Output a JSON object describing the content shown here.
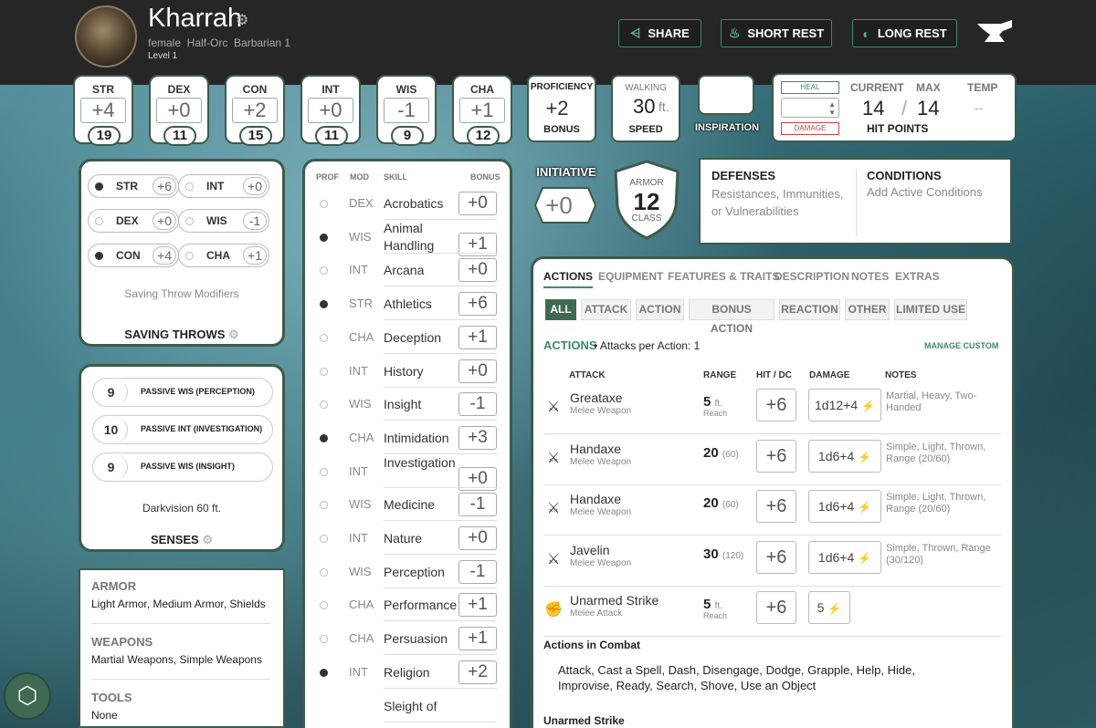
{
  "header": {
    "name": "Kharrah",
    "gear_icon": "gear-icon",
    "description": "female  Half-Orc  Barbarian 1",
    "level": "Level 1",
    "buttons": [
      {
        "label": "SHARE",
        "icon": "share-icon"
      },
      {
        "label": "SHORT REST",
        "icon": "campfire-icon"
      },
      {
        "label": "LONG REST",
        "icon": "moon-icon"
      }
    ],
    "logo": "anvil-logo",
    "accent_color": "#3f8a6a"
  },
  "abilities": [
    {
      "name": "STR",
      "mod": "+4",
      "score": "19"
    },
    {
      "name": "DEX",
      "mod": "+0",
      "score": "11"
    },
    {
      "name": "CON",
      "mod": "+2",
      "score": "15"
    },
    {
      "name": "INT",
      "mod": "+0",
      "score": "11"
    },
    {
      "name": "WIS",
      "mod": "-1",
      "score": "9"
    },
    {
      "name": "CHA",
      "mod": "+1",
      "score": "12"
    }
  ],
  "proficiency": {
    "label_top": "PROFICIENCY",
    "value": "+2",
    "label_bottom": "BONUS"
  },
  "speed": {
    "label_top": "WALKING",
    "value": "30",
    "unit": "ft.",
    "label_bottom": "SPEED"
  },
  "inspiration": {
    "label": "INSPIRATION"
  },
  "hit_points": {
    "heal_label": "HEAL",
    "damage_label": "DAMAGE",
    "current_label": "CURRENT",
    "max_label": "MAX",
    "temp_label": "TEMP",
    "current": "14",
    "separator": "/",
    "max": "14",
    "temp": "--",
    "label": "HIT POINTS"
  },
  "initiative": {
    "label": "INITIATIVE",
    "value": "+0"
  },
  "armor": {
    "label_top": "ARMOR",
    "value": "12",
    "label_bottom": "CLASS"
  },
  "defenses": {
    "title": "DEFENSES",
    "text": "Resistances, Immunities, or Vulnerabilities"
  },
  "conditions": {
    "title": "CONDITIONS",
    "text": "Add Active Conditions"
  },
  "saving_throws": {
    "items": [
      {
        "name": "STR",
        "value": "+6",
        "proficient": true
      },
      {
        "name": "INT",
        "value": "+0",
        "proficient": false
      },
      {
        "name": "DEX",
        "value": "+0",
        "proficient": false
      },
      {
        "name": "WIS",
        "value": "-1",
        "proficient": false
      },
      {
        "name": "CON",
        "value": "+4",
        "proficient": true
      },
      {
        "name": "CHA",
        "value": "+1",
        "proficient": false
      }
    ],
    "modifiers_label": "Saving Throw Modifiers",
    "title": "SAVING THROWS"
  },
  "senses": {
    "items": [
      {
        "value": "9",
        "label": "PASSIVE WIS (PERCEPTION)"
      },
      {
        "value": "10",
        "label": "PASSIVE INT (INVESTIGATION)"
      },
      {
        "value": "9",
        "label": "PASSIVE WIS (INSIGHT)"
      }
    ],
    "darkvision": "Darkvision 60 ft.",
    "title": "SENSES"
  },
  "proficiencies": {
    "armor_title": "ARMOR",
    "armor": "Light Armor, Medium Armor, Shields",
    "weapons_title": "WEAPONS",
    "weapons": "Martial Weapons, Simple Weapons",
    "tools_title": "TOOLS",
    "tools": "None"
  },
  "skills": {
    "headers": {
      "prof": "PROF",
      "mod": "MOD",
      "skill": "SKILL",
      "bonus": "BONUS"
    },
    "items": [
      {
        "mod": "DEX",
        "name": "Acrobatics",
        "bonus": "+0",
        "proficient": false
      },
      {
        "mod": "WIS",
        "name": "Animal Handling",
        "bonus": "+1",
        "proficient": true
      },
      {
        "mod": "INT",
        "name": "Arcana",
        "bonus": "+0",
        "proficient": false
      },
      {
        "mod": "STR",
        "name": "Athletics",
        "bonus": "+6",
        "proficient": true
      },
      {
        "mod": "CHA",
        "name": "Deception",
        "bonus": "+1",
        "proficient": false
      },
      {
        "mod": "INT",
        "name": "History",
        "bonus": "+0",
        "proficient": false
      },
      {
        "mod": "WIS",
        "name": "Insight",
        "bonus": "-1",
        "proficient": false
      },
      {
        "mod": "CHA",
        "name": "Intimidation",
        "bonus": "+3",
        "proficient": true
      },
      {
        "mod": "INT",
        "name": "Investigation",
        "bonus": "+0",
        "proficient": false
      },
      {
        "mod": "WIS",
        "name": "Medicine",
        "bonus": "-1",
        "proficient": false
      },
      {
        "mod": "INT",
        "name": "Nature",
        "bonus": "+0",
        "proficient": false
      },
      {
        "mod": "WIS",
        "name": "Perception",
        "bonus": "-1",
        "proficient": false
      },
      {
        "mod": "CHA",
        "name": "Performance",
        "bonus": "+1",
        "proficient": false
      },
      {
        "mod": "CHA",
        "name": "Persuasion",
        "bonus": "+1",
        "proficient": false
      },
      {
        "mod": "INT",
        "name": "Religion",
        "bonus": "+2",
        "proficient": true
      },
      {
        "mod": "",
        "name": "Sleight of",
        "bonus": "",
        "proficient": false
      }
    ]
  },
  "actions_panel": {
    "tabs": [
      "ACTIONS",
      "EQUIPMENT",
      "FEATURES & TRAITS",
      "DESCRIPTION",
      "NOTES",
      "EXTRAS"
    ],
    "filters": [
      "ALL",
      "ATTACK",
      "ACTION",
      "BONUS ACTION",
      "REACTION",
      "OTHER",
      "LIMITED USE"
    ],
    "section_title": "ACTIONS",
    "attacks_per_action": "• Attacks per Action: 1",
    "manage_custom": "MANAGE CUSTOM",
    "columns": {
      "attack": "ATTACK",
      "range": "RANGE",
      "hit": "HIT / DC",
      "damage": "DAMAGE",
      "notes": "NOTES"
    },
    "attacks": [
      {
        "icon": "crossed-swords-icon",
        "name": "Greataxe",
        "type": "Melee Weapon",
        "range": "5",
        "range_unit": "ft.",
        "range_sub": "Reach",
        "hit": "+6",
        "damage": "1d12+4",
        "notes": "Martial, Heavy, Two-Handed"
      },
      {
        "icon": "crossed-swords-icon",
        "name": "Handaxe",
        "type": "Melee Weapon",
        "range": "20",
        "range_unit": "(60)",
        "range_sub": "",
        "hit": "+6",
        "damage": "1d6+4",
        "notes": "Simple, Light, Thrown, Range (20/60)"
      },
      {
        "icon": "crossed-swords-icon",
        "name": "Handaxe",
        "type": "Melee Weapon",
        "range": "20",
        "range_unit": "(60)",
        "range_sub": "",
        "hit": "+6",
        "damage": "1d6+4",
        "notes": "Simple, Light, Thrown, Range (20/60)"
      },
      {
        "icon": "crossed-swords-icon",
        "name": "Javelin",
        "type": "Melee Weapon",
        "range": "30",
        "range_unit": "(120)",
        "range_sub": "",
        "hit": "+6",
        "damage": "1d6+4",
        "notes": "Simple, Thrown, Range (30/120)"
      },
      {
        "icon": "fist-icon",
        "name": "Unarmed Strike",
        "type": "Melee Attack",
        "range": "5",
        "range_unit": "ft.",
        "range_sub": "Reach",
        "hit": "+6",
        "damage": "5",
        "notes": ""
      }
    ],
    "combat_title": "Actions in Combat",
    "combat_text": "Attack, Cast a Spell, Dash, Disengage, Dodge, Grapple, Help, Hide, Improvise, Ready, Search, Shove, Use an Object",
    "unarmed_title": "Unarmed Strike"
  },
  "dice_button": {
    "icon": "d20-icon"
  }
}
